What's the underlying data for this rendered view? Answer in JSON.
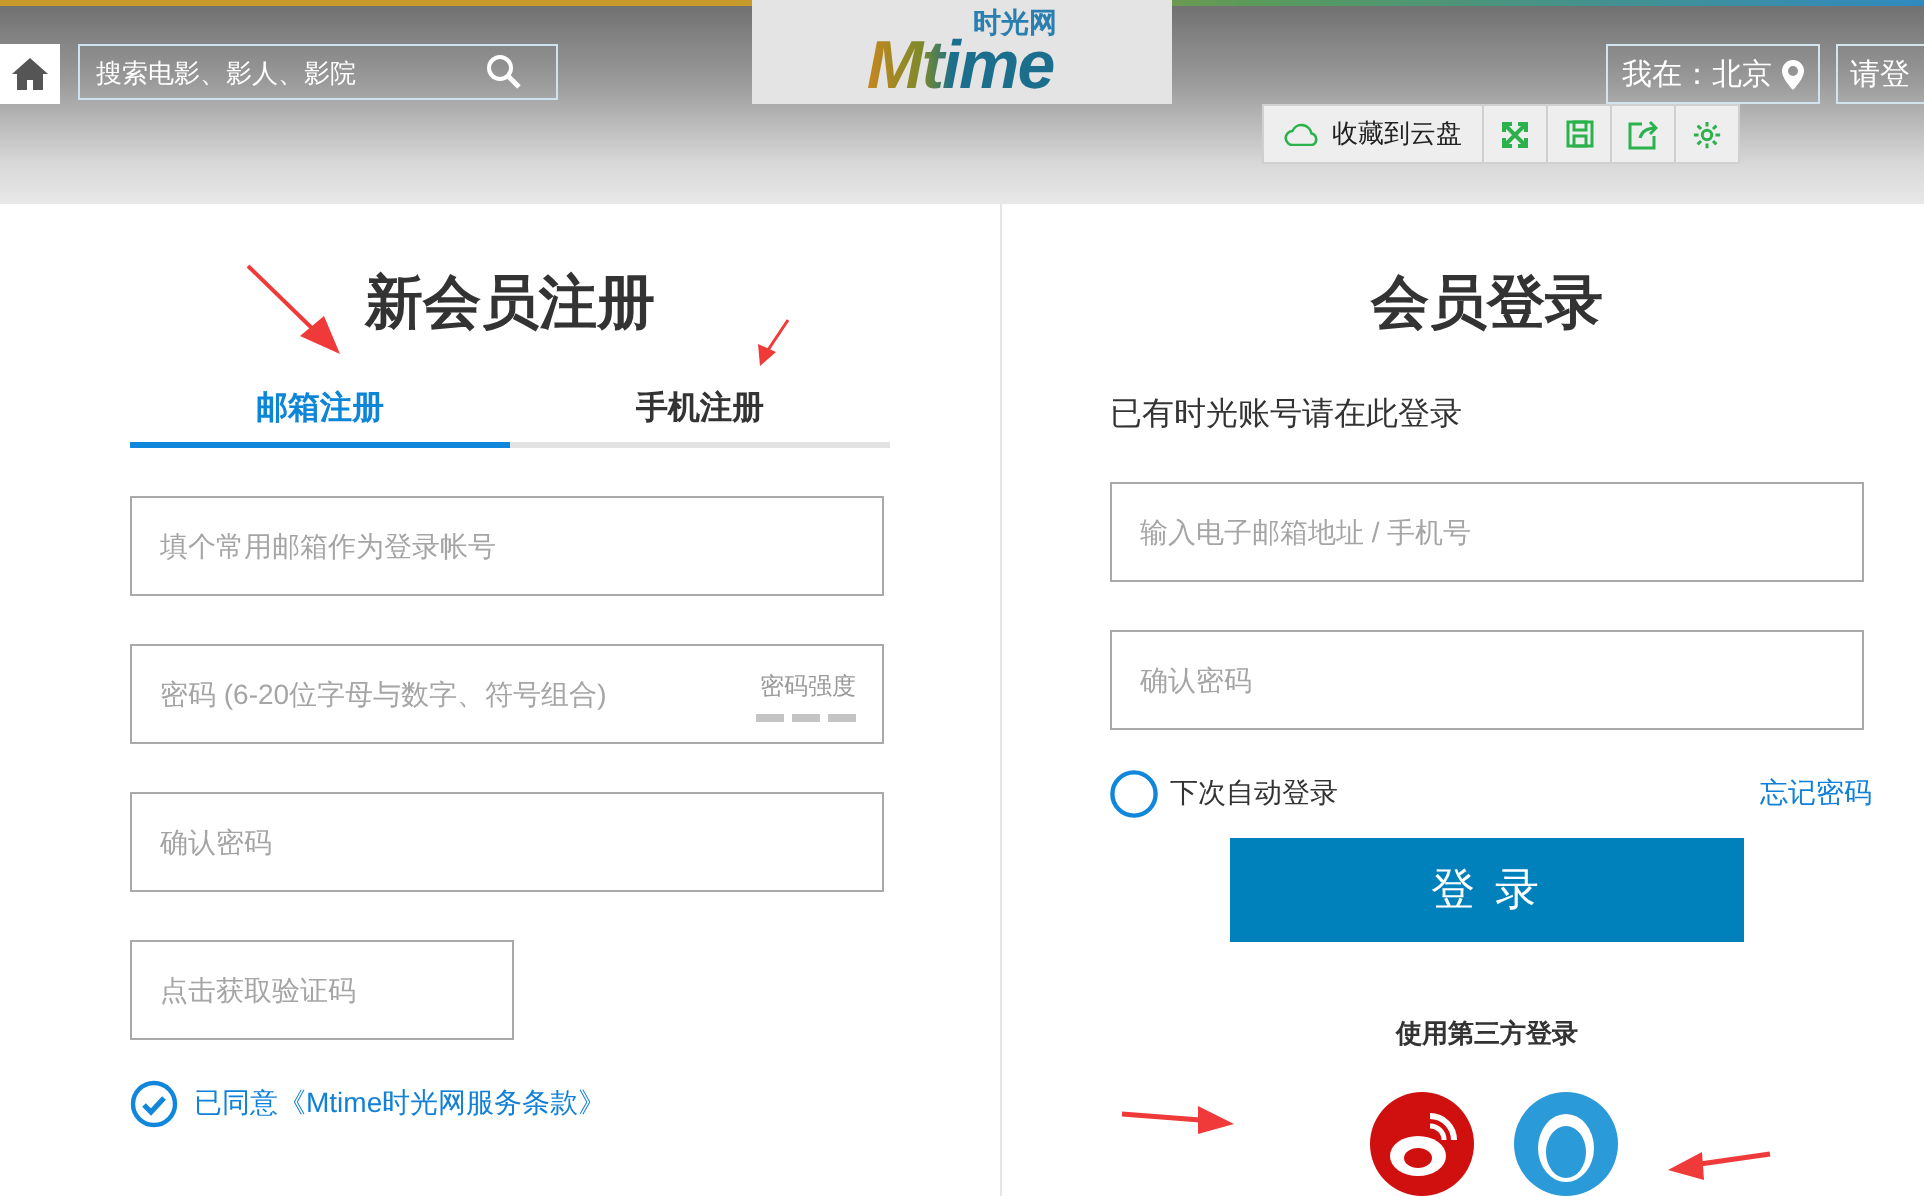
{
  "header": {
    "search": {
      "placeholder": "搜索电影、影人、影院"
    },
    "logo": {
      "text": "Mtime",
      "subtitle": "时光网"
    },
    "location": "我在：北京",
    "login_link": "请登",
    "toolbar": {
      "save_label": "收藏到云盘"
    }
  },
  "register": {
    "title": "新会员注册",
    "tabs": [
      {
        "label": "邮箱注册",
        "selected": true
      },
      {
        "label": "手机注册",
        "selected": false
      }
    ],
    "fields": [
      {
        "kind": "text",
        "placeholder": "填个常用邮箱作为登录帐号"
      },
      {
        "kind": "password",
        "placeholder": "密码 (6-20位字母与数字、符号组合)",
        "strength_label": "密码强度"
      },
      {
        "kind": "text",
        "placeholder": "确认密码"
      },
      {
        "kind": "short",
        "placeholder": "点击获取验证码"
      }
    ],
    "agreement": {
      "checked": true,
      "text": "已同意《Mtime时光网服务条款》"
    }
  },
  "login": {
    "title": "会员登录",
    "subtitle": "已有时光账号请在此登录",
    "fields": [
      {
        "kind": "text",
        "placeholder": "输入电子邮箱地址 / 手机号"
      },
      {
        "kind": "text",
        "placeholder": "确认密码"
      }
    ],
    "remember": {
      "checked": false,
      "label": "下次自动登录"
    },
    "forgot_link": "忘记密码",
    "button": "登 录",
    "third_party_title": "使用第三方登录"
  }
}
